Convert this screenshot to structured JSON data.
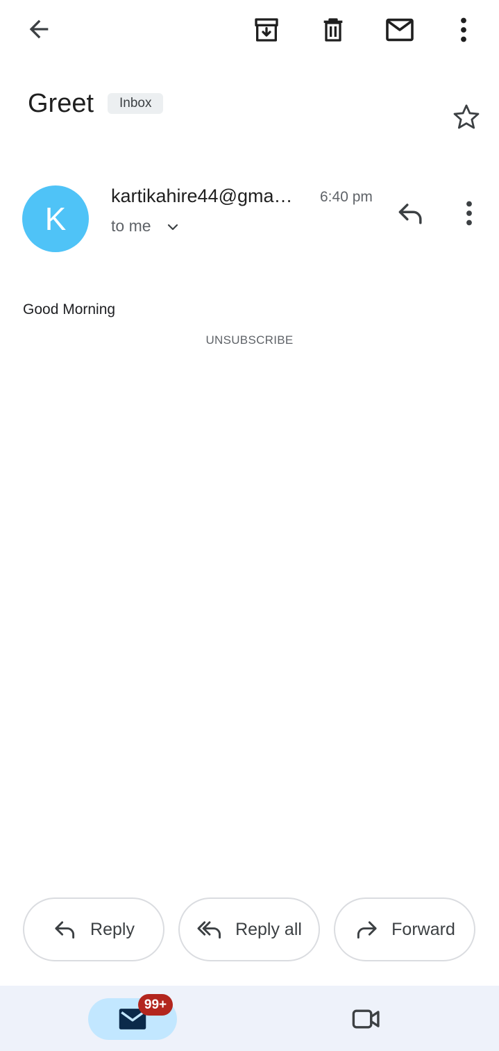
{
  "toolbar": {
    "back_icon": "arrow-back-icon",
    "archive_icon": "archive-icon",
    "delete_icon": "delete-icon",
    "mark_unread_icon": "mail-icon",
    "more_icon": "more-vert-icon"
  },
  "email": {
    "subject": "Greet",
    "label": "Inbox",
    "starred": false,
    "sender_initial": "K",
    "sender": "kartikahire44@gma…",
    "time": "6:40 pm",
    "recipient": "to me",
    "body": "Good Morning",
    "unsubscribe": "UNSUBSCRIBE"
  },
  "actions": {
    "reply": "Reply",
    "reply_all": "Reply all",
    "forward": "Forward"
  },
  "bottom_nav": {
    "mail_badge": "99+",
    "mail_icon": "mail-icon",
    "meet_icon": "videocam-icon"
  },
  "colors": {
    "avatar": "#4fc3f7",
    "nav_active": "#c2e7ff",
    "badge": "#b3261e",
    "nav_background": "#eef2fa"
  }
}
